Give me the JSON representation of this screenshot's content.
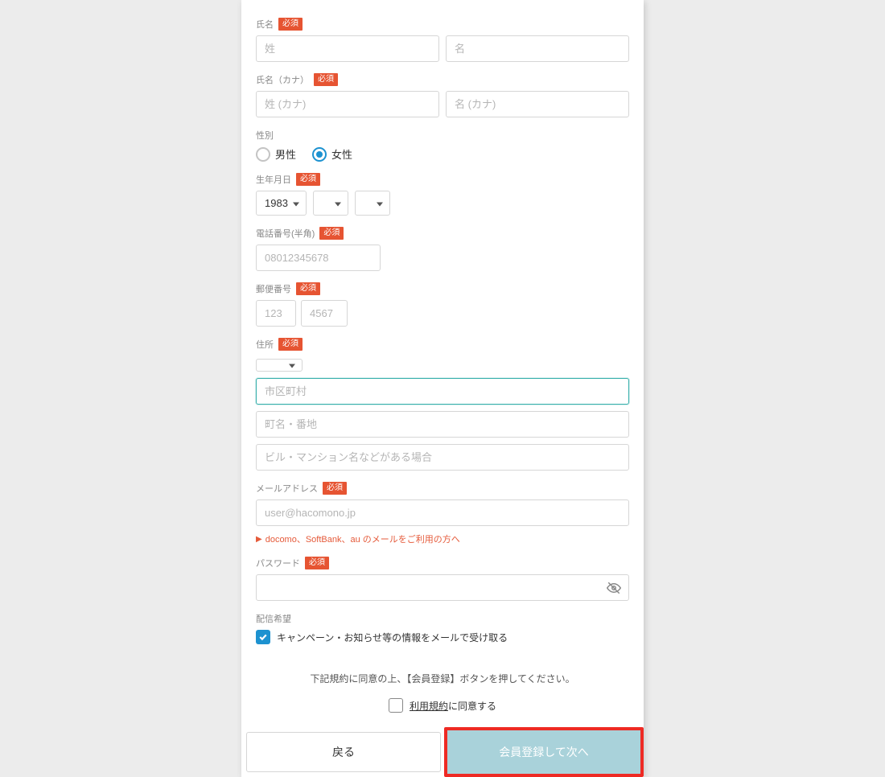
{
  "common": {
    "required_badge": "必須"
  },
  "name": {
    "label": "氏名",
    "last_placeholder": "姓",
    "first_placeholder": "名"
  },
  "name_kana": {
    "label": "氏名（カナ）",
    "last_placeholder": "姓 (カナ)",
    "first_placeholder": "名 (カナ)"
  },
  "gender": {
    "label": "性別",
    "male": "男性",
    "female": "女性",
    "selected": "female"
  },
  "birthdate": {
    "label": "生年月日",
    "year": "1983",
    "month": "",
    "day": ""
  },
  "phone": {
    "label": "電話番号(半角)",
    "placeholder": "08012345678"
  },
  "postal": {
    "label": "郵便番号",
    "placeholder1": "123",
    "placeholder2": "4567"
  },
  "address": {
    "label": "住所",
    "city_placeholder": "市区町村",
    "street_placeholder": "町名・番地",
    "building_placeholder": "ビル・マンション名などがある場合"
  },
  "email": {
    "label": "メールアドレス",
    "placeholder": "user@hacomono.jp",
    "carrier_notice": "docomo、SoftBank、au のメールをご利用の方へ"
  },
  "password": {
    "label": "パスワード"
  },
  "newsletter": {
    "label": "配信希望",
    "checkbox_label": "キャンペーン・お知らせ等の情報をメールで受け取る"
  },
  "footer": {
    "instruction": "下記規約に同意の上、【会員登録】ボタンを押してください。",
    "terms_link": "利用規約",
    "terms_suffix": "に同意する",
    "back_button": "戻る",
    "submit_button": "会員登録して次へ"
  }
}
